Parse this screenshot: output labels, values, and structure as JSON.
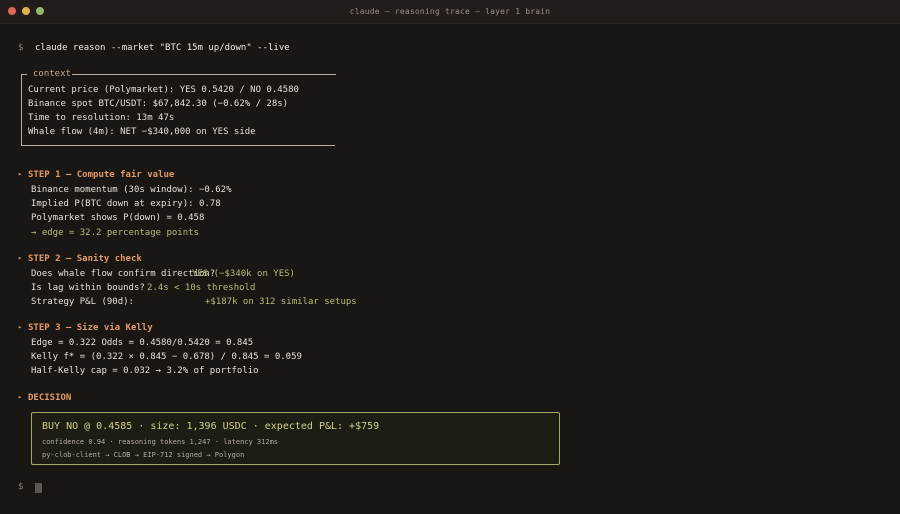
{
  "window": {
    "title": "claude — reasoning trace — layer 1 brain"
  },
  "prompt_symbol": "$",
  "command": "claude reason --market \"BTC 15m up/down\" --live",
  "context": {
    "label": "context",
    "lines": [
      "Current price (Polymarket): YES 0.5420 / NO 0.4580",
      "Binance spot BTC/USDT: $67,842.30 (−0.62% / 28s)",
      "Time to resolution: 13m 47s",
      "Whale flow (4m): NET −$340,000 on YES side"
    ]
  },
  "steps": [
    {
      "title": "STEP 1 — Compute fair value",
      "lines": [
        "Binance momentum (30s window): −0.62%",
        "Implied P(BTC down at expiry): 0.78",
        "Polymarket shows P(down) = 0.458"
      ],
      "result": "→ edge = 32.2 percentage points"
    },
    {
      "title": "STEP 2 — Sanity check",
      "checks": [
        {
          "label": "Does whale flow confirm direction?",
          "value": "YES (−$340k on YES)"
        },
        {
          "label": "Is lag within bounds?",
          "value": "2.4s < 10s threshold"
        },
        {
          "label": "Strategy P&L (90d):",
          "value": "+$187k on 312 similar setups"
        }
      ]
    },
    {
      "title": "STEP 3 — Size via Kelly",
      "lines": [
        "Edge = 0.322 Odds = 0.4580/0.5420 = 0.845",
        "Kelly f* = (0.322 × 0.845 − 0.678) / 0.845 = 0.059",
        "Half-Kelly cap = 0.032 → 3.2% of portfolio"
      ]
    }
  ],
  "decision": {
    "title": "DECISION",
    "main": "BUY NO @ 0.4585 · size: 1,396 USDC · expected P&L: +$759",
    "meta": "confidence 0.94 · reasoning tokens 1,247 · latency 312ms",
    "route": "py-clob-client → CLOB → EIP-712 signed → Polygon"
  },
  "colors": {
    "background": "#1a1614",
    "step_accent": "#e09a6a",
    "value_green": "#b8bd7a",
    "decision_border": "#a7a868"
  }
}
